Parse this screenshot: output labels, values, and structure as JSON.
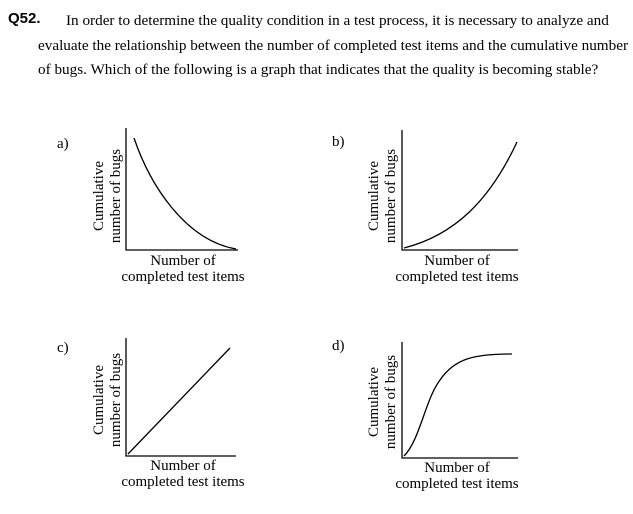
{
  "question": {
    "number": "Q52.",
    "text": "In order to determine the quality condition in a test process, it is necessary to analyze and evaluate the relationship between the number of completed test items and the cumulative number of bugs. Which of the following is a graph that indicates that the quality is becoming stable?"
  },
  "options": [
    {
      "label": "a)",
      "ylabel_line1": "Cumulative",
      "ylabel_line2": "number of bugs",
      "xlabel_line1": "Number of",
      "xlabel_line2": "completed test items",
      "shape": "decreasing-convex"
    },
    {
      "label": "b)",
      "ylabel_line1": "Cumulative",
      "ylabel_line2": "number of bugs",
      "xlabel_line1": "Number of",
      "xlabel_line2": "completed test items",
      "shape": "increasing-convex"
    },
    {
      "label": "c)",
      "ylabel_line1": "Cumulative",
      "ylabel_line2": "number of bugs",
      "xlabel_line1": "Number of",
      "xlabel_line2": "completed test items",
      "shape": "linear"
    },
    {
      "label": "d)",
      "ylabel_line1": "Cumulative",
      "ylabel_line2": "number of bugs",
      "xlabel_line1": "Number of",
      "xlabel_line2": "completed test items",
      "shape": "s-curve-plateau"
    }
  ]
}
